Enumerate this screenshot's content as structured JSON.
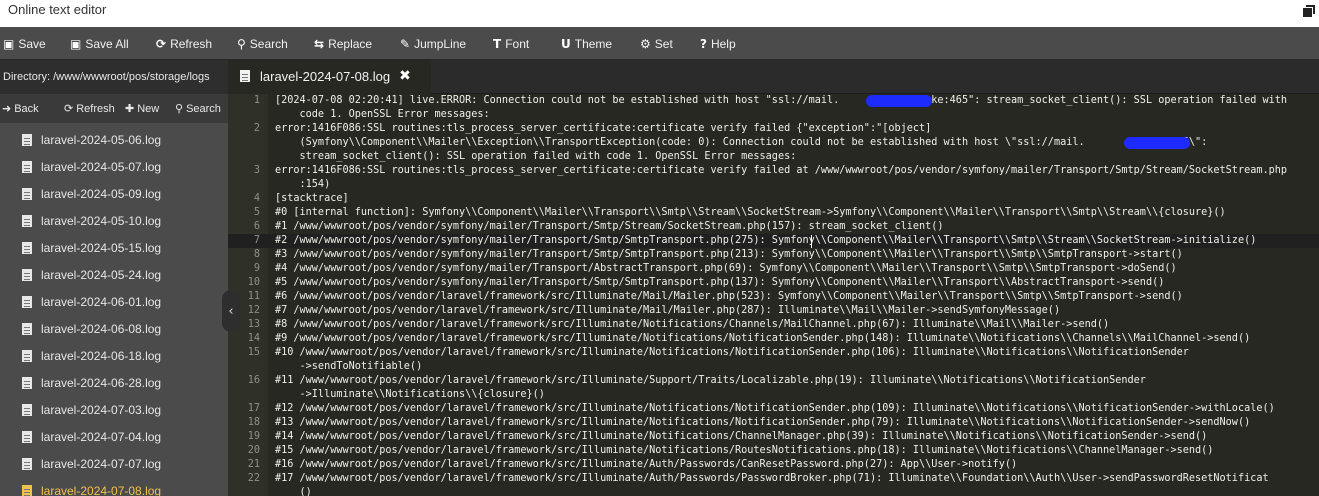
{
  "window": {
    "title": "Online text editor"
  },
  "toolbar": {
    "save": "Save",
    "save_all": "Save All",
    "refresh": "Refresh",
    "search": "Search",
    "replace": "Replace",
    "jumpline": "JumpLine",
    "font": "Font",
    "theme": "Theme",
    "set": "Set",
    "help": "Help"
  },
  "sidebar": {
    "directory": "Directory: /www/wwwroot/pos/storage/logs",
    "back": "Back",
    "refresh": "Refresh",
    "new": "New",
    "search": "Search",
    "files": [
      "laravel-2024-05-06.log",
      "laravel-2024-05-07.log",
      "laravel-2024-05-09.log",
      "laravel-2024-05-10.log",
      "laravel-2024-05-15.log",
      "laravel-2024-05-24.log",
      "laravel-2024-06-01.log",
      "laravel-2024-06-08.log",
      "laravel-2024-06-18.log",
      "laravel-2024-06-28.log",
      "laravel-2024-07-03.log",
      "laravel-2024-07-04.log",
      "laravel-2024-07-07.log",
      "laravel-2024-07-08.log"
    ],
    "active_file": "laravel-2024-07-08.log"
  },
  "editor": {
    "tab_name": "laravel-2024-07-08.log",
    "lines": [
      {
        "n": "1",
        "t": "[2024-07-08 02:20:41] live.ERROR: Connection could not be established with host \"ssl://mail.              .ke:465\": stream_socket_client(): SSL operation failed with"
      },
      {
        "n": "",
        "t": "    code 1. OpenSSL Error messages:"
      },
      {
        "n": "2",
        "t": "error:1416F086:SSL routines:tls_process_server_certificate:certificate verify failed {\"exception\":\"[object]"
      },
      {
        "n": "",
        "t": "    (Symfony\\\\Component\\\\Mailer\\\\Exception\\\\TransportException(code: 0): Connection could not be established with host \\\"ssl://mail.          .ke:465\\\":"
      },
      {
        "n": "",
        "t": "    stream_socket_client(): SSL operation failed with code 1. OpenSSL Error messages:"
      },
      {
        "n": "3",
        "t": "error:1416F086:SSL routines:tls_process_server_certificate:certificate verify failed at /www/wwwroot/pos/vendor/symfony/mailer/Transport/Smtp/Stream/SocketStream.php"
      },
      {
        "n": "",
        "t": "    :154)"
      },
      {
        "n": "4",
        "t": "[stacktrace]"
      },
      {
        "n": "5",
        "t": "#0 [internal function]: Symfony\\\\Component\\\\Mailer\\\\Transport\\\\Smtp\\\\Stream\\\\SocketStream->Symfony\\\\Component\\\\Mailer\\\\Transport\\\\Smtp\\\\Stream\\\\{closure}()"
      },
      {
        "n": "6",
        "t": "#1 /www/wwwroot/pos/vendor/symfony/mailer/Transport/Smtp/Stream/SocketStream.php(157): stream_socket_client()"
      },
      {
        "n": "7",
        "t": "#2 /www/wwwroot/pos/vendor/symfony/mailer/Transport/Smtp/SmtpTransport.php(275): Symfony\\\\Component\\\\Mailer\\\\Transport\\\\Smtp\\\\Stream\\\\SocketStream->initialize()"
      },
      {
        "n": "8",
        "t": "#3 /www/wwwroot/pos/vendor/symfony/mailer/Transport/Smtp/SmtpTransport.php(213): Symfony\\\\Component\\\\Mailer\\\\Transport\\\\Smtp\\\\SmtpTransport->start()"
      },
      {
        "n": "9",
        "t": "#4 /www/wwwroot/pos/vendor/symfony/mailer/Transport/AbstractTransport.php(69): Symfony\\\\Component\\\\Mailer\\\\Transport\\\\Smtp\\\\SmtpTransport->doSend()"
      },
      {
        "n": "10",
        "t": "#5 /www/wwwroot/pos/vendor/symfony/mailer/Transport/Smtp/SmtpTransport.php(137): Symfony\\\\Component\\\\Mailer\\\\Transport\\\\AbstractTransport->send()"
      },
      {
        "n": "11",
        "t": "#6 /www/wwwroot/pos/vendor/laravel/framework/src/Illuminate/Mail/Mailer.php(523): Symfony\\\\Component\\\\Mailer\\\\Transport\\\\Smtp\\\\SmtpTransport->send()"
      },
      {
        "n": "12",
        "t": "#7 /www/wwwroot/pos/vendor/laravel/framework/src/Illuminate/Mail/Mailer.php(287): Illuminate\\\\Mail\\\\Mailer->sendSymfonyMessage()"
      },
      {
        "n": "13",
        "t": "#8 /www/wwwroot/pos/vendor/laravel/framework/src/Illuminate/Notifications/Channels/MailChannel.php(67): Illuminate\\\\Mail\\\\Mailer->send()"
      },
      {
        "n": "14",
        "t": "#9 /www/wwwroot/pos/vendor/laravel/framework/src/Illuminate/Notifications/NotificationSender.php(148): Illuminate\\\\Notifications\\\\Channels\\\\MailChannel->send()"
      },
      {
        "n": "15",
        "t": "#10 /www/wwwroot/pos/vendor/laravel/framework/src/Illuminate/Notifications/NotificationSender.php(106): Illuminate\\\\Notifications\\\\NotificationSender"
      },
      {
        "n": "",
        "t": "    ->sendToNotifiable()"
      },
      {
        "n": "16",
        "t": "#11 /www/wwwroot/pos/vendor/laravel/framework/src/Illuminate/Support/Traits/Localizable.php(19): Illuminate\\\\Notifications\\\\NotificationSender"
      },
      {
        "n": "",
        "t": "    ->Illuminate\\\\Notifications\\\\{closure}()"
      },
      {
        "n": "17",
        "t": "#12 /www/wwwroot/pos/vendor/laravel/framework/src/Illuminate/Notifications/NotificationSender.php(109): Illuminate\\\\Notifications\\\\NotificationSender->withLocale()"
      },
      {
        "n": "18",
        "t": "#13 /www/wwwroot/pos/vendor/laravel/framework/src/Illuminate/Notifications/NotificationSender.php(79): Illuminate\\\\Notifications\\\\NotificationSender->sendNow()"
      },
      {
        "n": "19",
        "t": "#14 /www/wwwroot/pos/vendor/laravel/framework/src/Illuminate/Notifications/ChannelManager.php(39): Illuminate\\\\Notifications\\\\NotificationSender->send()"
      },
      {
        "n": "20",
        "t": "#15 /www/wwwroot/pos/vendor/laravel/framework/src/Illuminate/Notifications/RoutesNotifications.php(18): Illuminate\\\\Notifications\\\\ChannelManager->send()"
      },
      {
        "n": "21",
        "t": "#16 /www/wwwroot/pos/vendor/laravel/framework/src/Illuminate/Auth/Passwords/CanResetPassword.php(27): App\\\\User->notify()"
      },
      {
        "n": "22",
        "t": "#17 /www/wwwroot/pos/vendor/laravel/framework/src/Illuminate/Auth/Passwords/PasswordBroker.php(71): Illuminate\\\\Foundation\\\\Auth\\\\User->sendPasswordResetNotificat"
      },
      {
        "n": "",
        "t": "    ()"
      }
    ]
  },
  "colors": {
    "toolbar_bg": "#4b4b4b",
    "editor_bg": "#272822",
    "active_file": "#f1c24b",
    "redaction": "#1e2bff"
  },
  "icons": [
    "floppy-icon",
    "floppy-multi-icon",
    "refresh-icon",
    "search-icon",
    "replace-icon",
    "pin-icon",
    "text-icon",
    "magnet-icon",
    "gear-icon",
    "help-icon",
    "back-arrow-icon",
    "plus-icon",
    "file-icon",
    "close-icon",
    "chevron-left-icon",
    "maximize-icon"
  ]
}
